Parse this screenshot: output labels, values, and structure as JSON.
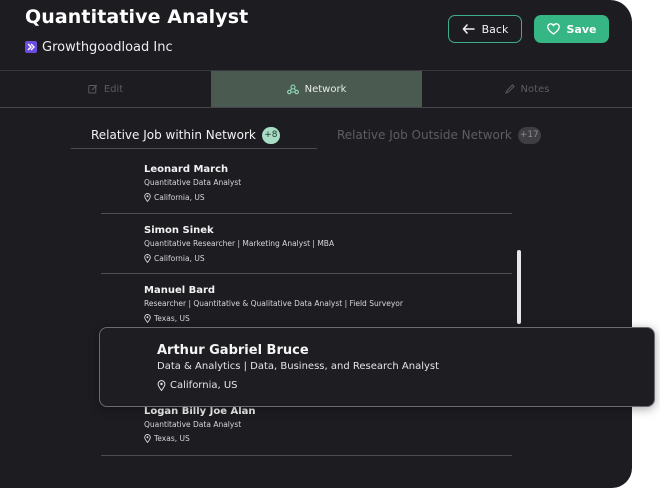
{
  "header": {
    "title": "Quantitative Analyst",
    "company": "Growthgoodload Inc",
    "back_label": "Back",
    "save_label": "Save"
  },
  "tabs": [
    {
      "label": "Edit",
      "icon": "edit-icon",
      "active": false
    },
    {
      "label": "Network",
      "icon": "network-icon",
      "active": true
    },
    {
      "label": "Notes",
      "icon": "notes-icon",
      "active": false
    }
  ],
  "subtabs": {
    "within": {
      "label": "Relative Job within Network",
      "count": "+8"
    },
    "outside": {
      "label": "Relative Job Outside Network",
      "count": "+17"
    }
  },
  "people": [
    {
      "name": "Leonard March",
      "role": "Quantitative Data Analyst",
      "location": "California, US"
    },
    {
      "name": "Simon Sinek",
      "role": "Quantitative Researcher | Marketing Analyst | MBA",
      "location": "California, US"
    },
    {
      "name": "Manuel Bard",
      "role": "Researcher | Quantitative & Qualitative Data Analyst | Field Surveyor",
      "location": "Texas, US"
    },
    {
      "name": "Logan Billy Joe Alan",
      "role": "Quantitative Data Analyst",
      "location": "Texas, US"
    }
  ],
  "highlight": {
    "name": "Arthur Gabriel Bruce",
    "role": "Data & Analytics | Data, Business, and Research Analyst",
    "location": "California, US"
  },
  "colors": {
    "background": "#1d1c21",
    "accent": "#36b585",
    "active_tab": "#4a5a51",
    "brand_logo": "#6c4ce0"
  }
}
